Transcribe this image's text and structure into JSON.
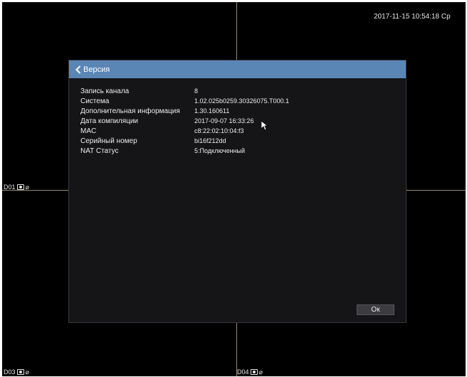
{
  "datetime": "2017-11-15 10:54:18 Ср",
  "channels": [
    {
      "label": "D01"
    },
    {
      "label": "D03"
    },
    {
      "label": "D04"
    }
  ],
  "dialog": {
    "title": "Версия",
    "rows": [
      {
        "label": "Запись канала",
        "value": "8"
      },
      {
        "label": "Система",
        "value": "1.02.025b0259.30326075.T000.1"
      },
      {
        "label": "Дополнительная информация",
        "value": "1.30.160611"
      },
      {
        "label": "Дата компиляции",
        "value": "2017-09-07 16:33:26"
      },
      {
        "label": "MAC",
        "value": "c8:22:02:10:04:f3"
      },
      {
        "label": "Серийный номер",
        "value": "bi16f212dd"
      },
      {
        "label": "NAT Статус",
        "value": "5:Подключенный"
      }
    ],
    "ok_label": "Ок"
  },
  "colors": {
    "header": "#5a86b6",
    "dialog_bg": "#151518",
    "grid_line": "#9a8c6a"
  },
  "icons": {
    "back": "chevron-left-icon",
    "record": "record-icon",
    "motion": "motion-icon",
    "cursor": "mouse-cursor-icon"
  }
}
